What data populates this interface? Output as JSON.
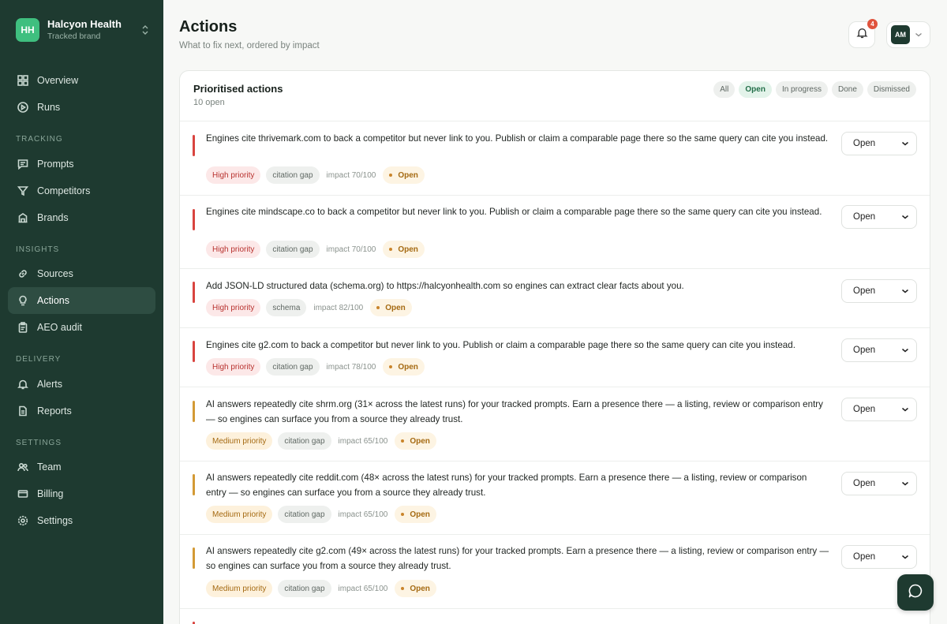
{
  "brand": {
    "initials": "HH",
    "name": "Halcyon Health",
    "subtitle": "Tracked brand"
  },
  "nav": {
    "overview": "Overview",
    "runs": "Runs",
    "section_tracking": "TRACKING",
    "prompts": "Prompts",
    "competitors": "Competitors",
    "brands": "Brands",
    "section_insights": "INSIGHTS",
    "sources": "Sources",
    "actions": "Actions",
    "aeo_audit": "AEO audit",
    "section_delivery": "DELIVERY",
    "alerts": "Alerts",
    "reports": "Reports",
    "section_settings": "SETTINGS",
    "team": "Team",
    "billing": "Billing",
    "settings": "Settings"
  },
  "header": {
    "title": "Actions",
    "subtitle": "What to fix next, ordered by impact",
    "notification_count": "4",
    "avatar_initials": "AM"
  },
  "card": {
    "title": "Prioritised actions",
    "count": "10 open",
    "filters": [
      "All",
      "Open",
      "In progress",
      "Done",
      "Dismissed"
    ],
    "active_filter": "Open"
  },
  "actions": [
    {
      "text": "Engines cite thrivemark.com to back a competitor but never link to you. Publish or claim a comparable page there so the same query can cite you instead.",
      "priority": "High priority",
      "type": "citation gap",
      "impact": "impact 70/100",
      "status": "Open",
      "select": "Open"
    },
    {
      "text": "Engines cite mindscape.co to back a competitor but never link to you. Publish or claim a comparable page there so the same query can cite you instead.",
      "priority": "High priority",
      "type": "citation gap",
      "impact": "impact 70/100",
      "status": "Open",
      "select": "Open"
    },
    {
      "text": "Add JSON-LD structured data (schema.org) to https://halcyonhealth.com so engines can extract clear facts about you.",
      "priority": "High priority",
      "type": "schema",
      "impact": "impact 82/100",
      "status": "Open",
      "select": "Open"
    },
    {
      "text": "Engines cite g2.com to back a competitor but never link to you. Publish or claim a comparable page there so the same query can cite you instead.",
      "priority": "High priority",
      "type": "citation gap",
      "impact": "impact 78/100",
      "status": "Open",
      "select": "Open"
    },
    {
      "text": "AI answers repeatedly cite shrm.org (31× across the latest runs) for your tracked prompts. Earn a presence there — a listing, review or comparison entry — so engines can surface you from a source they already trust.",
      "priority": "Medium priority",
      "type": "citation gap",
      "impact": "impact 65/100",
      "status": "Open",
      "select": "Open"
    },
    {
      "text": "AI answers repeatedly cite reddit.com (48× across the latest runs) for your tracked prompts. Earn a presence there — a listing, review or comparison entry — so engines can surface you from a source they already trust.",
      "priority": "Medium priority",
      "type": "citation gap",
      "impact": "impact 65/100",
      "status": "Open",
      "select": "Open"
    },
    {
      "text": "AI answers repeatedly cite g2.com (49× across the latest runs) for your tracked prompts. Earn a presence there — a listing, review or comparison entry — so engines can surface you from a source they already trust.",
      "priority": "Medium priority",
      "type": "citation gap",
      "impact": "impact 65/100",
      "status": "Open",
      "select": "Open"
    }
  ],
  "colors": {
    "sidebar": "#1e3a30",
    "high_bar": "#d9443f",
    "medium_bar": "#d39a35",
    "accent": "#3fbf7f"
  }
}
